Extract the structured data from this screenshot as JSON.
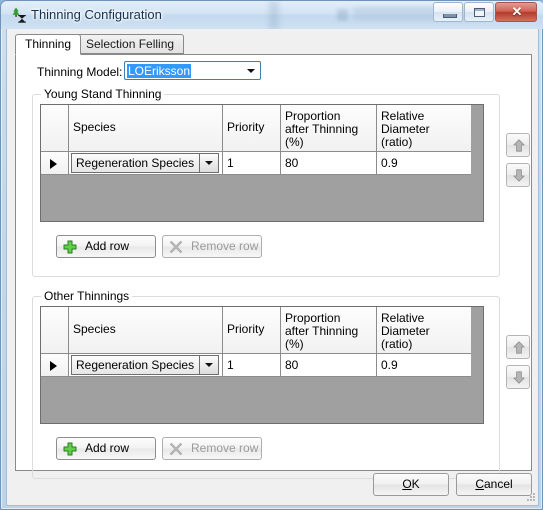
{
  "window": {
    "title": "Thinning Configuration",
    "app_icon": "tree-hourglass-icon",
    "controls": {
      "minimize": "minimize-icon",
      "maximize": "maximize-icon",
      "close": "✕"
    }
  },
  "tabs": [
    {
      "label": "Thinning",
      "active": true
    },
    {
      "label": "Selection Felling",
      "active": false
    }
  ],
  "form": {
    "model_label": "Thinning Model:",
    "model_value": "LOEriksson",
    "model_options": [
      "LOEriksson"
    ]
  },
  "sections": [
    {
      "title": "Young Stand Thinning",
      "grid": {
        "columns": [
          "",
          "Species",
          "Priority",
          "Proportion after Thinning (%)",
          "Relative Diameter (ratio)"
        ],
        "column_lines": [
          {
            "line1": "Species",
            "line2": "",
            "line3": ""
          },
          {
            "line1": "Priority",
            "line2": "",
            "line3": ""
          },
          {
            "line1": "Proportion",
            "line2": "after Thinning",
            "line3": "(%)"
          },
          {
            "line1": "Relative",
            "line2": "Diameter",
            "line3": "(ratio)"
          }
        ],
        "rows": [
          {
            "species": "Regeneration Species",
            "priority": "1",
            "proportion": "80",
            "diameter": "0.9",
            "selected": true
          }
        ]
      },
      "buttons": {
        "add": "Add row",
        "remove": "Remove row",
        "remove_enabled": false
      },
      "reorder": {
        "up": "move-up-icon",
        "down": "move-down-icon"
      }
    },
    {
      "title": "Other Thinnings",
      "grid": {
        "columns": [
          "",
          "Species",
          "Priority",
          "Proportion after Thinning (%)",
          "Relative Diameter (ratio)"
        ],
        "column_lines": [
          {
            "line1": "Species",
            "line2": "",
            "line3": ""
          },
          {
            "line1": "Priority",
            "line2": "",
            "line3": ""
          },
          {
            "line1": "Proportion",
            "line2": "after Thinning",
            "line3": "(%)"
          },
          {
            "line1": "Relative",
            "line2": "Diameter",
            "line3": "(ratio)"
          }
        ],
        "rows": [
          {
            "species": "Regeneration Species",
            "priority": "1",
            "proportion": "80",
            "diameter": "0.9",
            "selected": true
          }
        ]
      },
      "buttons": {
        "add": "Add row",
        "remove": "Remove row",
        "remove_enabled": false
      },
      "reorder": {
        "up": "move-up-icon",
        "down": "move-down-icon"
      }
    }
  ],
  "footer": {
    "ok": {
      "before": "",
      "mnemonic": "O",
      "after": "K"
    },
    "cancel": {
      "before": "",
      "mnemonic": "C",
      "after": "ancel"
    }
  },
  "colors": {
    "selection_blue": "#3399ff",
    "grid_empty": "#a0a0a0",
    "close_red": "#b33a2b",
    "tree_green": "#2f9e2f"
  }
}
